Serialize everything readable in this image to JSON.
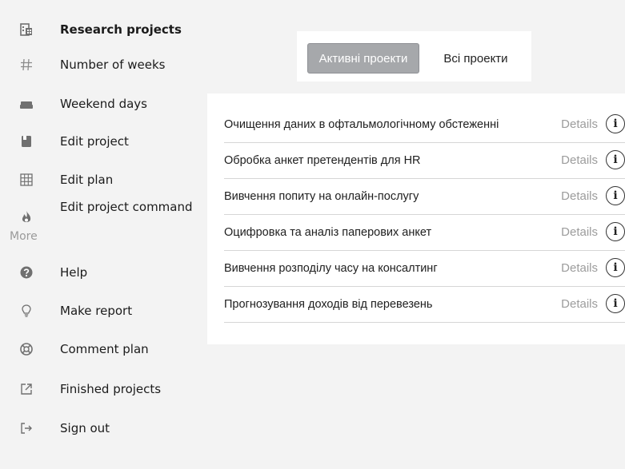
{
  "sidebar": {
    "items": [
      {
        "label": "Research projects",
        "icon": "building-icon"
      },
      {
        "label": "Number of weeks",
        "icon": "hash-icon"
      },
      {
        "label": "Weekend days",
        "icon": "sofa-icon"
      },
      {
        "label": "Edit project",
        "icon": "bookmark-icon"
      },
      {
        "label": "Edit plan",
        "icon": "grid-icon"
      },
      {
        "label": "Edit project command",
        "icon": "fire-icon"
      }
    ],
    "more_label": "More",
    "more_items": [
      {
        "label": "Help",
        "icon": "question-icon"
      },
      {
        "label": "Make report",
        "icon": "lightbulb-icon"
      },
      {
        "label": "Comment plan",
        "icon": "lifebuoy-icon"
      },
      {
        "label": "Finished projects",
        "icon": "external-link-icon"
      },
      {
        "label": "Sign out",
        "icon": "sign-out-icon"
      }
    ]
  },
  "tabs": {
    "active": "Активні проекти",
    "all": "Всі проекти"
  },
  "projects": [
    {
      "title": "Очищення даних в офтальмологічному обстеженні",
      "details": "Details"
    },
    {
      "title": "Обробка анкет претендентів для HR",
      "details": "Details"
    },
    {
      "title": "Вивчення попиту на онлайн-послугу",
      "details": "Details"
    },
    {
      "title": "Оцифровка та аналіз паперових анкет",
      "details": "Details"
    },
    {
      "title": "Вивчення розподілу часу на консалтинг",
      "details": "Details"
    },
    {
      "title": "Прогнозування доходів від перевезень",
      "details": "Details"
    }
  ],
  "info_glyph": "i"
}
